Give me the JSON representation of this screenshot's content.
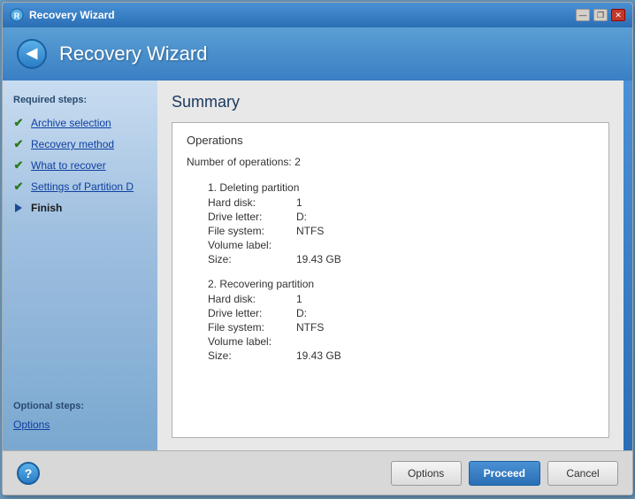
{
  "window": {
    "title": "Recovery Wizard",
    "titlebar_buttons": {
      "minimize": "—",
      "restore": "❐",
      "close": "✕"
    }
  },
  "header": {
    "title": "Recovery Wizard",
    "back_label": "◀"
  },
  "sidebar": {
    "required_label": "Required steps:",
    "items": [
      {
        "id": "archive-selection",
        "label": "Archive selection",
        "state": "done"
      },
      {
        "id": "recovery-method",
        "label": "Recovery method",
        "state": "done"
      },
      {
        "id": "what-to-recover",
        "label": "What to recover",
        "state": "done"
      },
      {
        "id": "settings-partition-d",
        "label": "Settings of Partition D",
        "state": "done"
      },
      {
        "id": "finish",
        "label": "Finish",
        "state": "active"
      }
    ],
    "optional_label": "Optional steps:",
    "optional_items": [
      {
        "id": "options",
        "label": "Options"
      }
    ]
  },
  "content": {
    "title": "Summary",
    "operations_label": "Operations",
    "num_operations_label": "Number of operations:",
    "num_operations_value": "2",
    "operation1": {
      "header": "1. Deleting partition",
      "fields": [
        {
          "key": "Hard disk:",
          "value": "1"
        },
        {
          "key": "Drive letter:",
          "value": "D:"
        },
        {
          "key": "File system:",
          "value": "NTFS"
        },
        {
          "key": "Volume label:",
          "value": ""
        },
        {
          "key": "Size:",
          "value": "19.43 GB"
        }
      ]
    },
    "operation2": {
      "header": "2. Recovering partition",
      "fields": [
        {
          "key": "Hard disk:",
          "value": "1"
        },
        {
          "key": "Drive letter:",
          "value": "D:"
        },
        {
          "key": "File system:",
          "value": "NTFS"
        },
        {
          "key": "Volume label:",
          "value": ""
        },
        {
          "key": "Size:",
          "value": "19.43 GB"
        }
      ]
    }
  },
  "footer": {
    "options_label": "Options",
    "proceed_label": "Proceed",
    "cancel_label": "Cancel"
  }
}
